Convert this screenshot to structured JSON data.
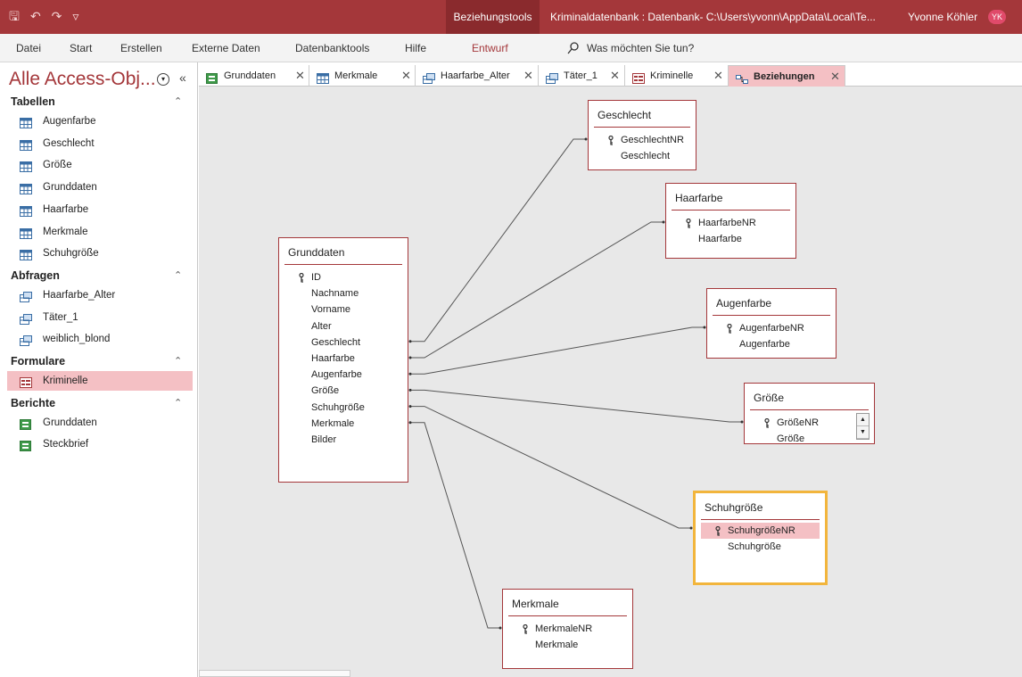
{
  "titlebar": {
    "context_tab": "Beziehungstools",
    "doc_title": "Kriminaldatenbank : Datenbank- C:\\Users\\yvonn\\AppData\\Local\\Te...",
    "user": "Yvonne Köhler",
    "initials": "YK",
    "accent": "#a4373a"
  },
  "menu": {
    "items": [
      "Datei",
      "Start",
      "Erstellen",
      "Externe Daten",
      "Datenbanktools",
      "Hilfe",
      "Entwurf"
    ],
    "active": "Entwurf",
    "tell_me": "Was möchten Sie tun?"
  },
  "nav": {
    "title": "Alle Access-Obj...",
    "groups": [
      {
        "label": "Tabellen",
        "icon": "table-icon",
        "items": [
          "Augenfarbe",
          "Geschlecht",
          "Größe",
          "Grunddaten",
          "Haarfarbe",
          "Merkmale",
          "Schuhgröße"
        ]
      },
      {
        "label": "Abfragen",
        "icon": "query-icon",
        "items": [
          "Haarfarbe_Alter",
          "Täter_1",
          "weiblich_blond"
        ]
      },
      {
        "label": "Formulare",
        "icon": "form-icon",
        "items": [
          "Kriminelle"
        ]
      },
      {
        "label": "Berichte",
        "icon": "report-icon",
        "items": [
          "Grunddaten",
          "Steckbrief"
        ]
      }
    ],
    "selected": "Kriminelle"
  },
  "tabs": [
    {
      "label": "Grunddaten",
      "icon": "report-icon"
    },
    {
      "label": "Merkmale",
      "icon": "table-icon"
    },
    {
      "label": "Haarfarbe_Alter",
      "icon": "query-icon"
    },
    {
      "label": "Täter_1",
      "icon": "query-icon"
    },
    {
      "label": "Kriminelle",
      "icon": "form-icon"
    },
    {
      "label": "Beziehungen",
      "icon": "relationship-icon",
      "active": true
    }
  ],
  "tables": [
    {
      "id": "grunddaten",
      "title": "Grunddaten",
      "fields": [
        "ID",
        "Nachname",
        "Vorname",
        "Alter",
        "Geschlecht",
        "Haarfarbe",
        "Augenfarbe",
        "Größe",
        "Schuhgröße",
        "Merkmale",
        "Bilder"
      ],
      "key": "ID"
    },
    {
      "id": "geschlecht",
      "title": "Geschlecht",
      "fields": [
        "GeschlechtNR",
        "Geschlecht"
      ],
      "key": "GeschlechtNR"
    },
    {
      "id": "haarfarbe",
      "title": "Haarfarbe",
      "fields": [
        "HaarfarbeNR",
        "Haarfarbe"
      ],
      "key": "HaarfarbeNR"
    },
    {
      "id": "augenfarbe",
      "title": "Augenfarbe",
      "fields": [
        "AugenfarbeNR",
        "Augenfarbe"
      ],
      "key": "AugenfarbeNR"
    },
    {
      "id": "groesse",
      "title": "Größe",
      "fields": [
        "GrößeNR",
        "Größe"
      ],
      "key": "GrößeNR"
    },
    {
      "id": "schuhgroesse",
      "title": "Schuhgröße",
      "fields": [
        "SchuhgrößeNR",
        "Schuhgröße"
      ],
      "key": "SchuhgrößeNR",
      "selected": true
    },
    {
      "id": "merkmale",
      "title": "Merkmale",
      "fields": [
        "MerkmaleNR",
        "Merkmale"
      ],
      "key": "MerkmaleNR"
    }
  ],
  "relationships": [
    {
      "from": "Geschlecht",
      "to": "geschlecht"
    },
    {
      "from": "Haarfarbe",
      "to": "haarfarbe"
    },
    {
      "from": "Augenfarbe",
      "to": "augenfarbe"
    },
    {
      "from": "Größe",
      "to": "groesse"
    },
    {
      "from": "Schuhgröße",
      "to": "schuhgroesse"
    },
    {
      "from": "Merkmale",
      "to": "merkmale"
    }
  ]
}
